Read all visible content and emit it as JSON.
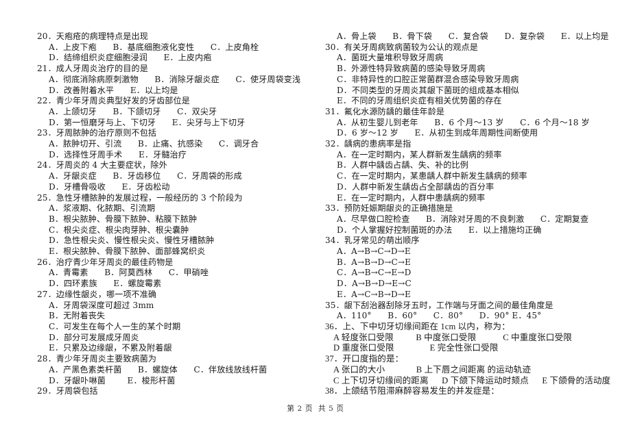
{
  "document": {
    "footer": "第 2 页  共 5 页"
  },
  "left_column": [
    {
      "stem": "20．天疱疮的病理特点是出现",
      "options": [
        "A．上皮下疱      B．基底细胞液化变性      C．上皮角栓",
        "D．结缔组织炎症细胞浸润      E．上皮内疱"
      ]
    },
    {
      "stem": "21．成人牙周炎治疗的目的是",
      "options": [
        "A．彻底消除病原刺激物      B．消除牙龈炎症      C．使牙周袋变浅",
        "D．改善附着水平      E．以上均是"
      ]
    },
    {
      "stem": "22．青少年牙周炎典型好发的牙齿部位是",
      "options": [
        "A．上颌切牙      B．下颌切牙      C．双尖牙",
        "D．第一恒磨牙与上、下切牙      E．尖牙与上下切牙"
      ]
    },
    {
      "stem": "23．牙周脓肿的治疗原则不包括",
      "options": [
        "A．脓肿切开、引流      B．止痛、抗感染      C．调牙合",
        "D．选择性牙周手术      E．牙髓治疗"
      ]
    },
    {
      "stem": "24．牙周炎的 4 大主要症状，除外",
      "options": [
        "A．牙龈炎症      B．牙齿移位      C．牙周袋的形成",
        "D．牙槽骨吸收      E．牙齿松动"
      ]
    },
    {
      "stem": "25．急性牙槽脓肿的发展过程，一般经历的 3 个阶段为",
      "options": [
        "A．浆液期、化脓期、引流期",
        "B．根尖脓肿、骨膜下脓肿、粘膜下脓肿",
        "C．根尖炎症、根尖肉芽肿、根尖囊肿",
        "D．急性根尖炎、慢性根尖炎、慢性牙槽脓肿",
        "E．根尖脓肿、骨膜下脓肿、面部蜂窝织炎"
      ]
    },
    {
      "stem": "26．治疗青少年牙周炎的最佳药物是",
      "options": [
        "A．青霉素      B．阿莫西林      C．甲硝唑",
        "D．四环素族      E．螺旋霉素"
      ]
    },
    {
      "stem": "27．边缘性龈炎，哪一项不准确",
      "options": [
        "A．牙周袋深度可超过 3mm",
        "B．无附着丧失",
        "C．可发生在每个人一生的某个时期",
        "D．部分可发展成牙周炎",
        "E．只累及边缘龈，不累及附着龈"
      ]
    },
    {
      "stem": "28．青少年牙周炎主要致病菌为",
      "options": [
        "A．产黑色素类杆菌      B．螺旋体      C．伴放线放线杆菌",
        "D．牙龈卟啉菌        E．梭形杆菌"
      ]
    },
    {
      "stem": "29．牙周袋包括",
      "options": []
    }
  ],
  "right_column_orphan_option": "A．骨上袋      B．骨下袋      C．复合袋      D．复杂袋      E．以上均是",
  "right_column": [
    {
      "stem": "30．有关牙周病致病菌较为公认的观点是",
      "options": [
        "A．菌斑大量堆积导致牙周病",
        "B．外源性特异致病菌的感染导致牙周病",
        "C．非特异性的口腔正常菌群混合感染导致牙周病",
        "D．不同类型的牙周炎其龈下菌斑的组成基本相似",
        "E．不同的牙周组织炎症有相关优势菌的存在"
      ]
    },
    {
      "stem": "31．氟化水源防龋的最佳年龄是",
      "options": [
        "A．从初生婴儿到老年      B．6 个月～13 岁      C．6 个月～18 岁",
        "D．6 岁～12 岁      E．从初生到成年周期性间断使用"
      ]
    },
    {
      "stem": "32．龋病的患病率是指",
      "options": [
        "A．在一定时期内，某人群新发生龋病的频率",
        "B．人群中龋齿占龋、失、补的比例",
        "C．在一定时期内，某患龋人群中新发生龋病的频率",
        "D．人群中新发生龋齿占全部龋齿的百分率",
        "E．在一定时期内，人群中患龋病的频率"
      ]
    },
    {
      "stem": "33．预防妊娠期龈炎的正确措施是",
      "options": [
        "A．尽早做口腔检查      B．消除对牙周的不良刺激      C．定期复查",
        "D．个人掌握好控制菌斑的办法      E．以上措施均正确"
      ]
    },
    {
      "stem": "34．乳牙常见的萌出顺序",
      "options": [
        "A．A→B→C→D→E",
        "B．A→B→D→C→E",
        "C．A→B→C→E→D",
        "D．A→B→D→E→C",
        "E．A→C→B→D→E"
      ]
    },
    {
      "stem": "35．龈下刮治器刮除牙五时，工作端与牙面之间的最佳角度是",
      "options": [
        "A．110°      B．60°      C．80°      D．90° E．45°"
      ]
    }
  ],
  "right_column_alt": [
    {
      "stem": "36．上、下中切牙切缘间距在 1cm 以内，称为：",
      "options": [
        "A 轻度张口受限          B 中度张口受限            C 中重度张口受限",
        "D 重度张口受限                E 完全性张口受限"
      ]
    },
    {
      "stem": "37．开口度指的是：",
      "options": [
        "A 张口的大小              B 上下唇之间距离 的运动轨迹",
        "C 上下切牙切缘间的距离      D 下颌下降运动时颏点      E 下颌骨的活动度"
      ]
    },
    {
      "stem": "38．上颌结节阻滞麻醉容易发生的并发症是：",
      "options": []
    }
  ]
}
